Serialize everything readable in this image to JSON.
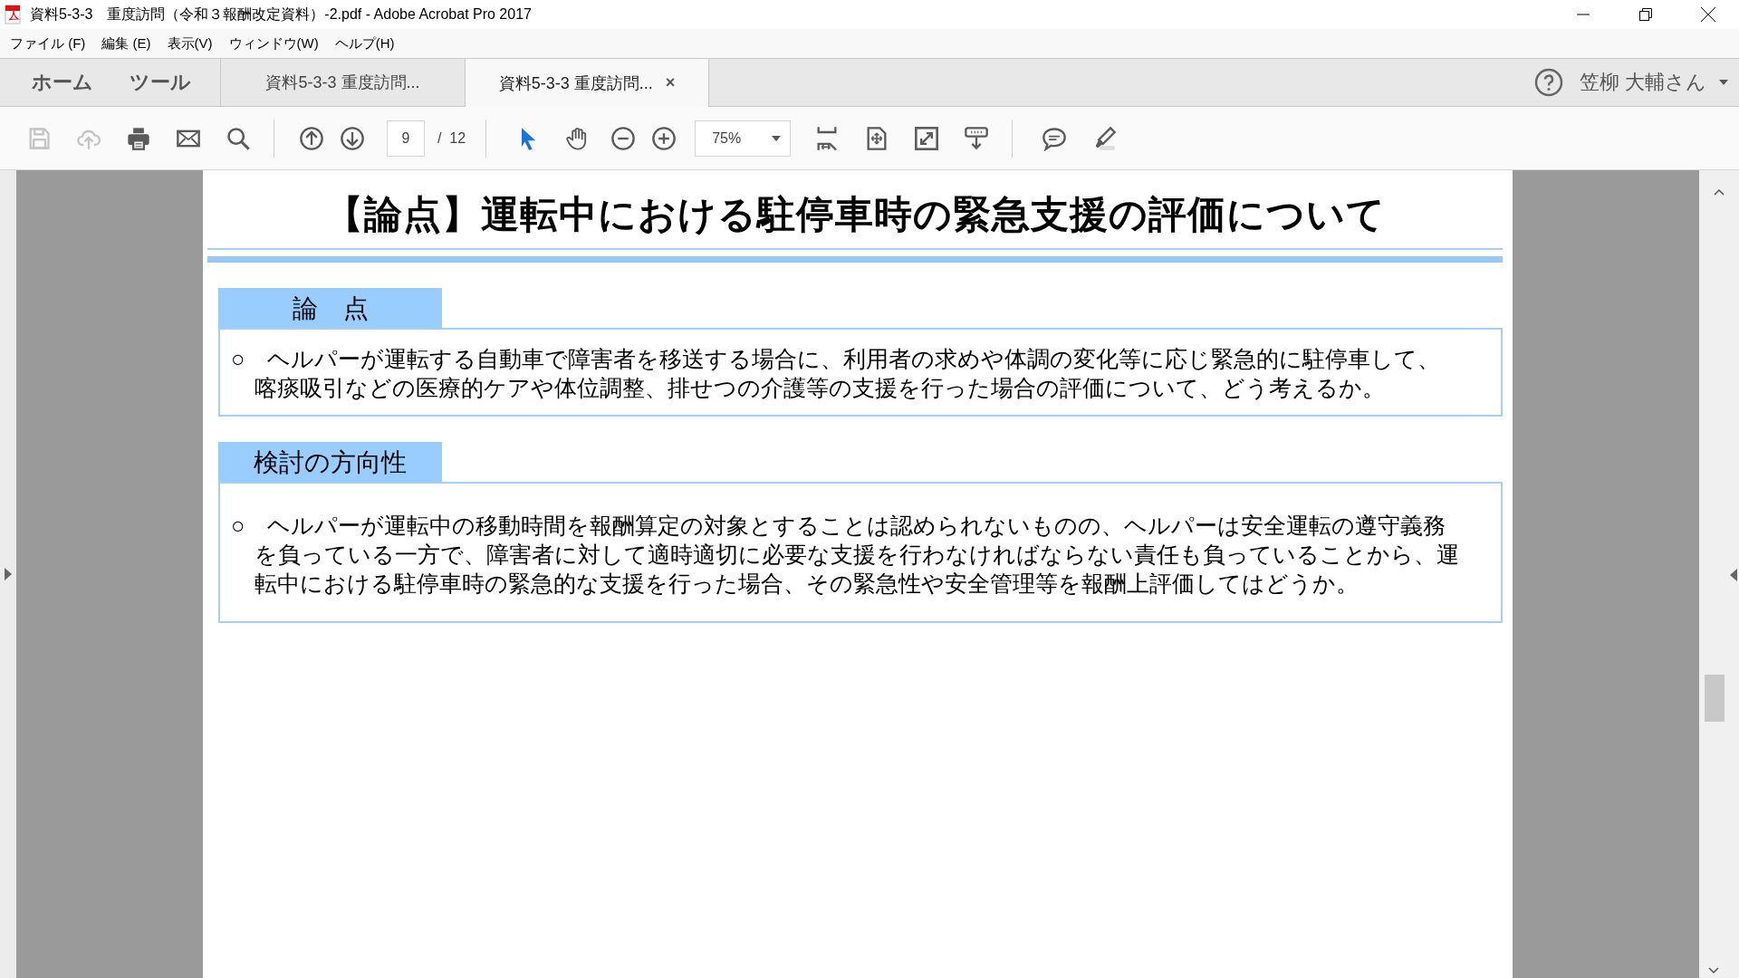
{
  "window": {
    "title": "資料5-3-3　重度訪問（令和３報酬改定資料）-2.pdf - Adobe Acrobat Pro 2017"
  },
  "menu": [
    "ファイル (F)",
    "編集 (E)",
    "表示(V)",
    "ウィンドウ(W)",
    "ヘルプ(H)"
  ],
  "tabs": [
    {
      "label": "ホーム",
      "kind": "nav",
      "selected": false
    },
    {
      "label": "ツール",
      "kind": "nav",
      "selected": false
    },
    {
      "label": "資料5-3-3  重度訪問...",
      "kind": "document",
      "selected": false
    },
    {
      "label": "資料5-3-3  重度訪問...",
      "kind": "document",
      "selected": true,
      "close": "×"
    }
  ],
  "user": {
    "name": "笠柳 大輔さん"
  },
  "toolbar": [
    {
      "kind": "save",
      "disabled": true
    },
    {
      "kind": "upload",
      "disabled": true
    },
    {
      "kind": "print",
      "disabled": false
    },
    {
      "kind": "mail",
      "disabled": false
    },
    {
      "kind": "search",
      "disabled": false
    },
    {
      "kind": "separator"
    },
    {
      "kind": "prev",
      "disabled": false
    },
    {
      "kind": "next",
      "disabled": false
    },
    {
      "kind": "page"
    },
    {
      "kind": "separator"
    },
    {
      "kind": "select",
      "disabled": false
    },
    {
      "kind": "hand",
      "disabled": false
    },
    {
      "kind": "zoomout",
      "disabled": false
    },
    {
      "kind": "zoomin",
      "disabled": false
    },
    {
      "kind": "zoom"
    },
    {
      "kind": "fitwidth",
      "disabled": false
    },
    {
      "kind": "fitpage",
      "disabled": false
    },
    {
      "kind": "fullscreen",
      "disabled": false
    },
    {
      "kind": "readmode",
      "disabled": false
    },
    {
      "kind": "separator"
    },
    {
      "kind": "comment",
      "disabled": false
    },
    {
      "kind": "highlight",
      "disabled": false
    }
  ],
  "page": {
    "current": "9",
    "total": "/  12"
  },
  "zoom": {
    "value": "75%"
  },
  "document": {
    "title": "【論点】運転中における駐停車時の緊急支援の評価について",
    "sections": [
      {
        "heading": "論　点",
        "lines": [
          "○　ヘルパーが運転する自動車で障害者を移送する場合に、利用者の求めや体調の変化等に応じ緊急的に駐停車して、",
          "喀痰吸引などの医療的ケアや体位調整、排せつの介護等の支援を行った場合の評価について、どう考えるか。"
        ]
      },
      {
        "heading": "検討の方向性",
        "lines": [
          "○　ヘルパーが運転中の移動時間を報酬算定の対象とすることは認められないものの、ヘルパーは安全運転の遵守義務",
          "を負っている一方で、障害者に対して適時適切に必要な支援を行わなければならない責任も負っていることから、運",
          "転中における駐停車時の緊急的な支援を行った場合、その緊急性や安全管理等を報酬上評価してはどうか。"
        ]
      }
    ]
  }
}
